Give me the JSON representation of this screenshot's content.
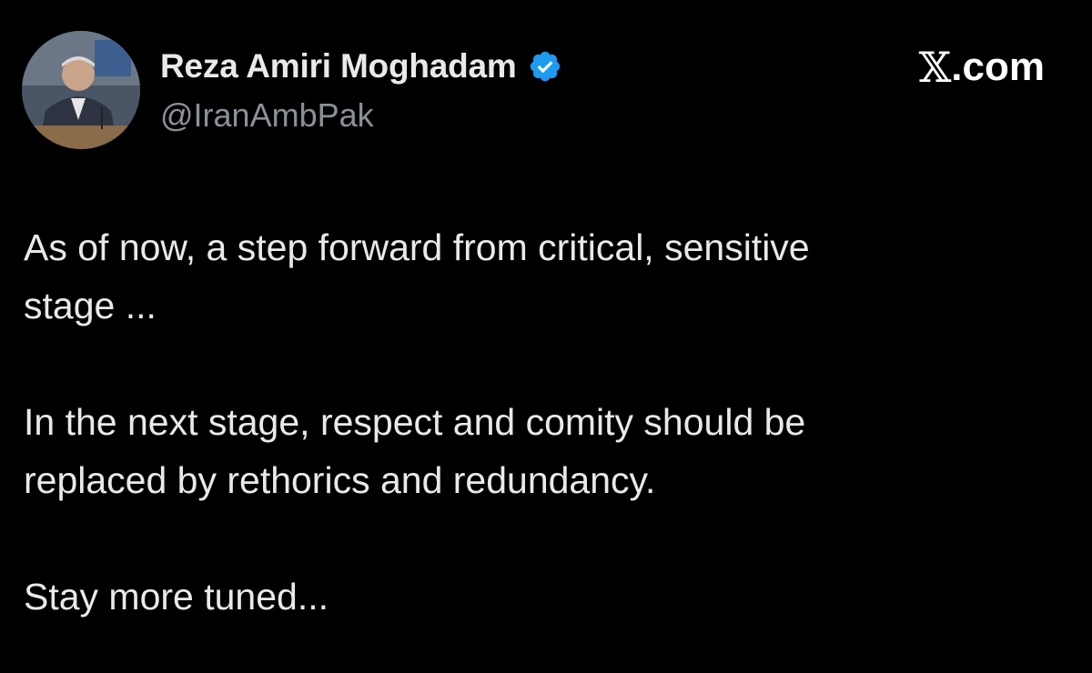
{
  "author": {
    "name": "Reza Amiri Moghadam",
    "handle": "@IranAmbPak",
    "verified": true,
    "avatar_icon": "profile-photo-avatar"
  },
  "brand": {
    "x_glyph": "𝕏",
    "suffix": ".com"
  },
  "tweet": {
    "paragraphs": [
      "As of now, a step forward from critical, sensitive\nstage ...",
      "In the next stage, respect and comity should be\nreplaced by rethorics and redundancy.",
      "Stay more tuned..."
    ]
  },
  "colors": {
    "background": "#000000",
    "text_primary": "#e7e9ea",
    "text_secondary": "#8b9198",
    "verified_blue": "#1d9bf0"
  }
}
